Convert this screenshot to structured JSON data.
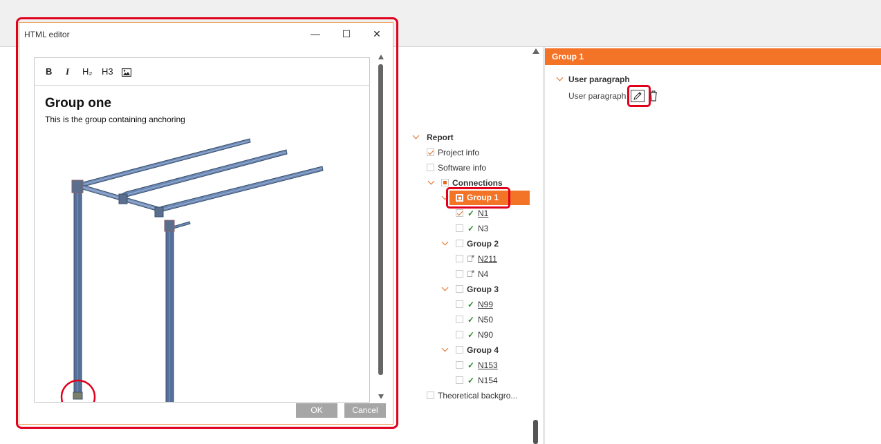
{
  "dialog": {
    "title": "HTML editor",
    "minimize": "—",
    "maximize": "☐",
    "close": "✕",
    "toolbar": {
      "bold": "B",
      "italic": "I",
      "h2": "H₂",
      "h3": "H3",
      "image_icon": "image-icon"
    },
    "heading": "Group one",
    "paragraph": "This is the group containing anchoring",
    "ok": "OK",
    "cancel": "Cancel"
  },
  "tree": {
    "report": "Report",
    "project_info": "Project info",
    "software_info": "Software info",
    "connections": "Connections",
    "groups": [
      {
        "label": "Group 1",
        "items": [
          {
            "label": "N1",
            "status": "ok",
            "link": true
          },
          {
            "label": "N3",
            "status": "ok",
            "link": false
          }
        ]
      },
      {
        "label": "Group 2",
        "items": [
          {
            "label": "N211",
            "status": "warn",
            "link": true
          },
          {
            "label": "N4",
            "status": "warn",
            "link": false
          }
        ]
      },
      {
        "label": "Group 3",
        "items": [
          {
            "label": "N99",
            "status": "ok",
            "link": true
          },
          {
            "label": "N50",
            "status": "ok",
            "link": false
          },
          {
            "label": "N90",
            "status": "ok",
            "link": false
          }
        ]
      },
      {
        "label": "Group 4",
        "items": [
          {
            "label": "N153",
            "status": "ok",
            "link": true
          },
          {
            "label": "N154",
            "status": "ok",
            "link": false
          }
        ]
      }
    ],
    "theoretical": "Theoretical backgro..."
  },
  "props": {
    "header": "Group 1",
    "section": "User paragraph",
    "row_label": "User paragraph"
  },
  "colors": {
    "accent": "#f47427",
    "highlight": "#e0001b",
    "ok": "#2a8a2a"
  }
}
